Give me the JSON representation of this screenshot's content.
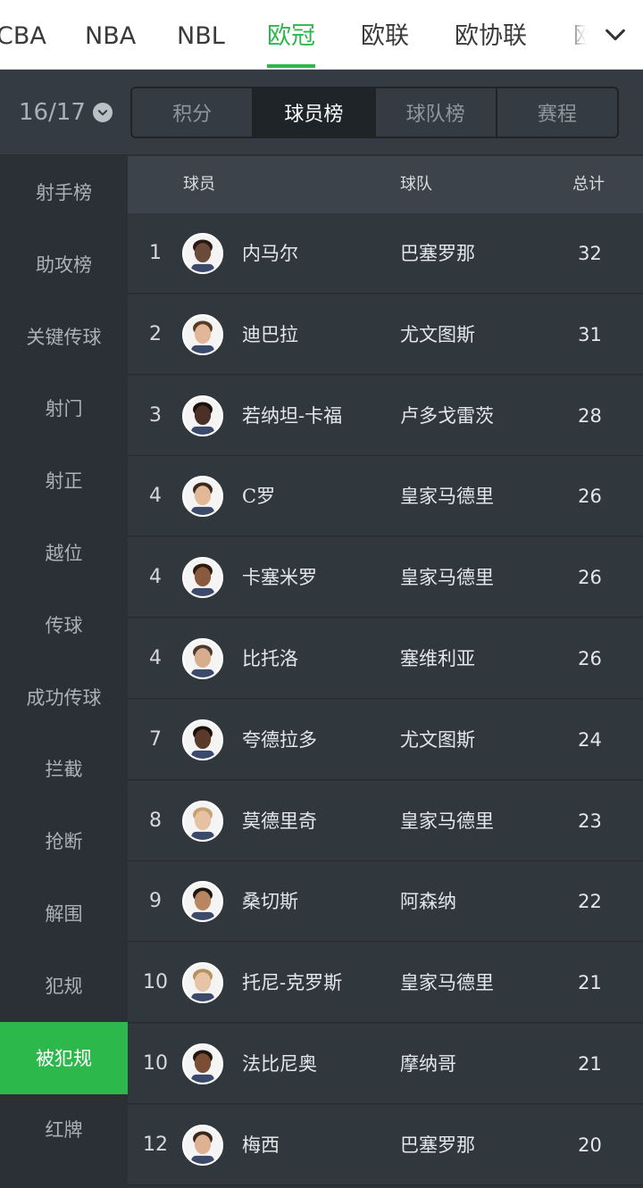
{
  "league_tabs": [
    {
      "label": "CBA",
      "active": false
    },
    {
      "label": "NBA",
      "active": false
    },
    {
      "label": "NBL",
      "active": false
    },
    {
      "label": "欧冠",
      "active": true
    },
    {
      "label": "欧联",
      "active": false
    },
    {
      "label": "欧协联",
      "active": false
    },
    {
      "label": "欧",
      "active": false
    }
  ],
  "season": "16/17",
  "segments": [
    {
      "label": "积分",
      "active": false
    },
    {
      "label": "球员榜",
      "active": true
    },
    {
      "label": "球队榜",
      "active": false
    },
    {
      "label": "赛程",
      "active": false
    }
  ],
  "categories": [
    {
      "label": "射手榜",
      "active": false
    },
    {
      "label": "助攻榜",
      "active": false
    },
    {
      "label": "关键传球",
      "active": false
    },
    {
      "label": "射门",
      "active": false
    },
    {
      "label": "射正",
      "active": false
    },
    {
      "label": "越位",
      "active": false
    },
    {
      "label": "传球",
      "active": false
    },
    {
      "label": "成功传球",
      "active": false
    },
    {
      "label": "拦截",
      "active": false
    },
    {
      "label": "抢断",
      "active": false
    },
    {
      "label": "解围",
      "active": false
    },
    {
      "label": "犯规",
      "active": false
    },
    {
      "label": "被犯规",
      "active": true
    },
    {
      "label": "红牌",
      "active": false
    }
  ],
  "table": {
    "headers": {
      "player": "球员",
      "team": "球队",
      "total": "总计"
    },
    "rows": [
      {
        "rank": "1",
        "name": "内马尔",
        "team": "巴塞罗那",
        "total": "32"
      },
      {
        "rank": "2",
        "name": "迪巴拉",
        "team": "尤文图斯",
        "total": "31"
      },
      {
        "rank": "3",
        "name": "若纳坦-卡福",
        "team": "卢多戈雷茨",
        "total": "28"
      },
      {
        "rank": "4",
        "name": "C罗",
        "team": "皇家马德里",
        "total": "26"
      },
      {
        "rank": "4",
        "name": "卡塞米罗",
        "team": "皇家马德里",
        "total": "26"
      },
      {
        "rank": "4",
        "name": "比托洛",
        "team": "塞维利亚",
        "total": "26"
      },
      {
        "rank": "7",
        "name": "夸德拉多",
        "team": "尤文图斯",
        "total": "24"
      },
      {
        "rank": "8",
        "name": "莫德里奇",
        "team": "皇家马德里",
        "total": "23"
      },
      {
        "rank": "9",
        "name": "桑切斯",
        "team": "阿森纳",
        "total": "22"
      },
      {
        "rank": "10",
        "name": "托尼-克罗斯",
        "team": "皇家马德里",
        "total": "21"
      },
      {
        "rank": "10",
        "name": "法比尼奥",
        "team": "摩纳哥",
        "total": "21"
      },
      {
        "rank": "12",
        "name": "梅西",
        "team": "巴塞罗那",
        "total": "20"
      }
    ]
  },
  "icons": {
    "more": "chevron-down-icon",
    "season_dropdown": "chevron-down-circle-icon",
    "avatar": "player-avatar-icon"
  },
  "colors": {
    "accent": "#2db84c",
    "panel": "#353b42",
    "sidebar": "#2a3035",
    "row": "#30373d"
  }
}
